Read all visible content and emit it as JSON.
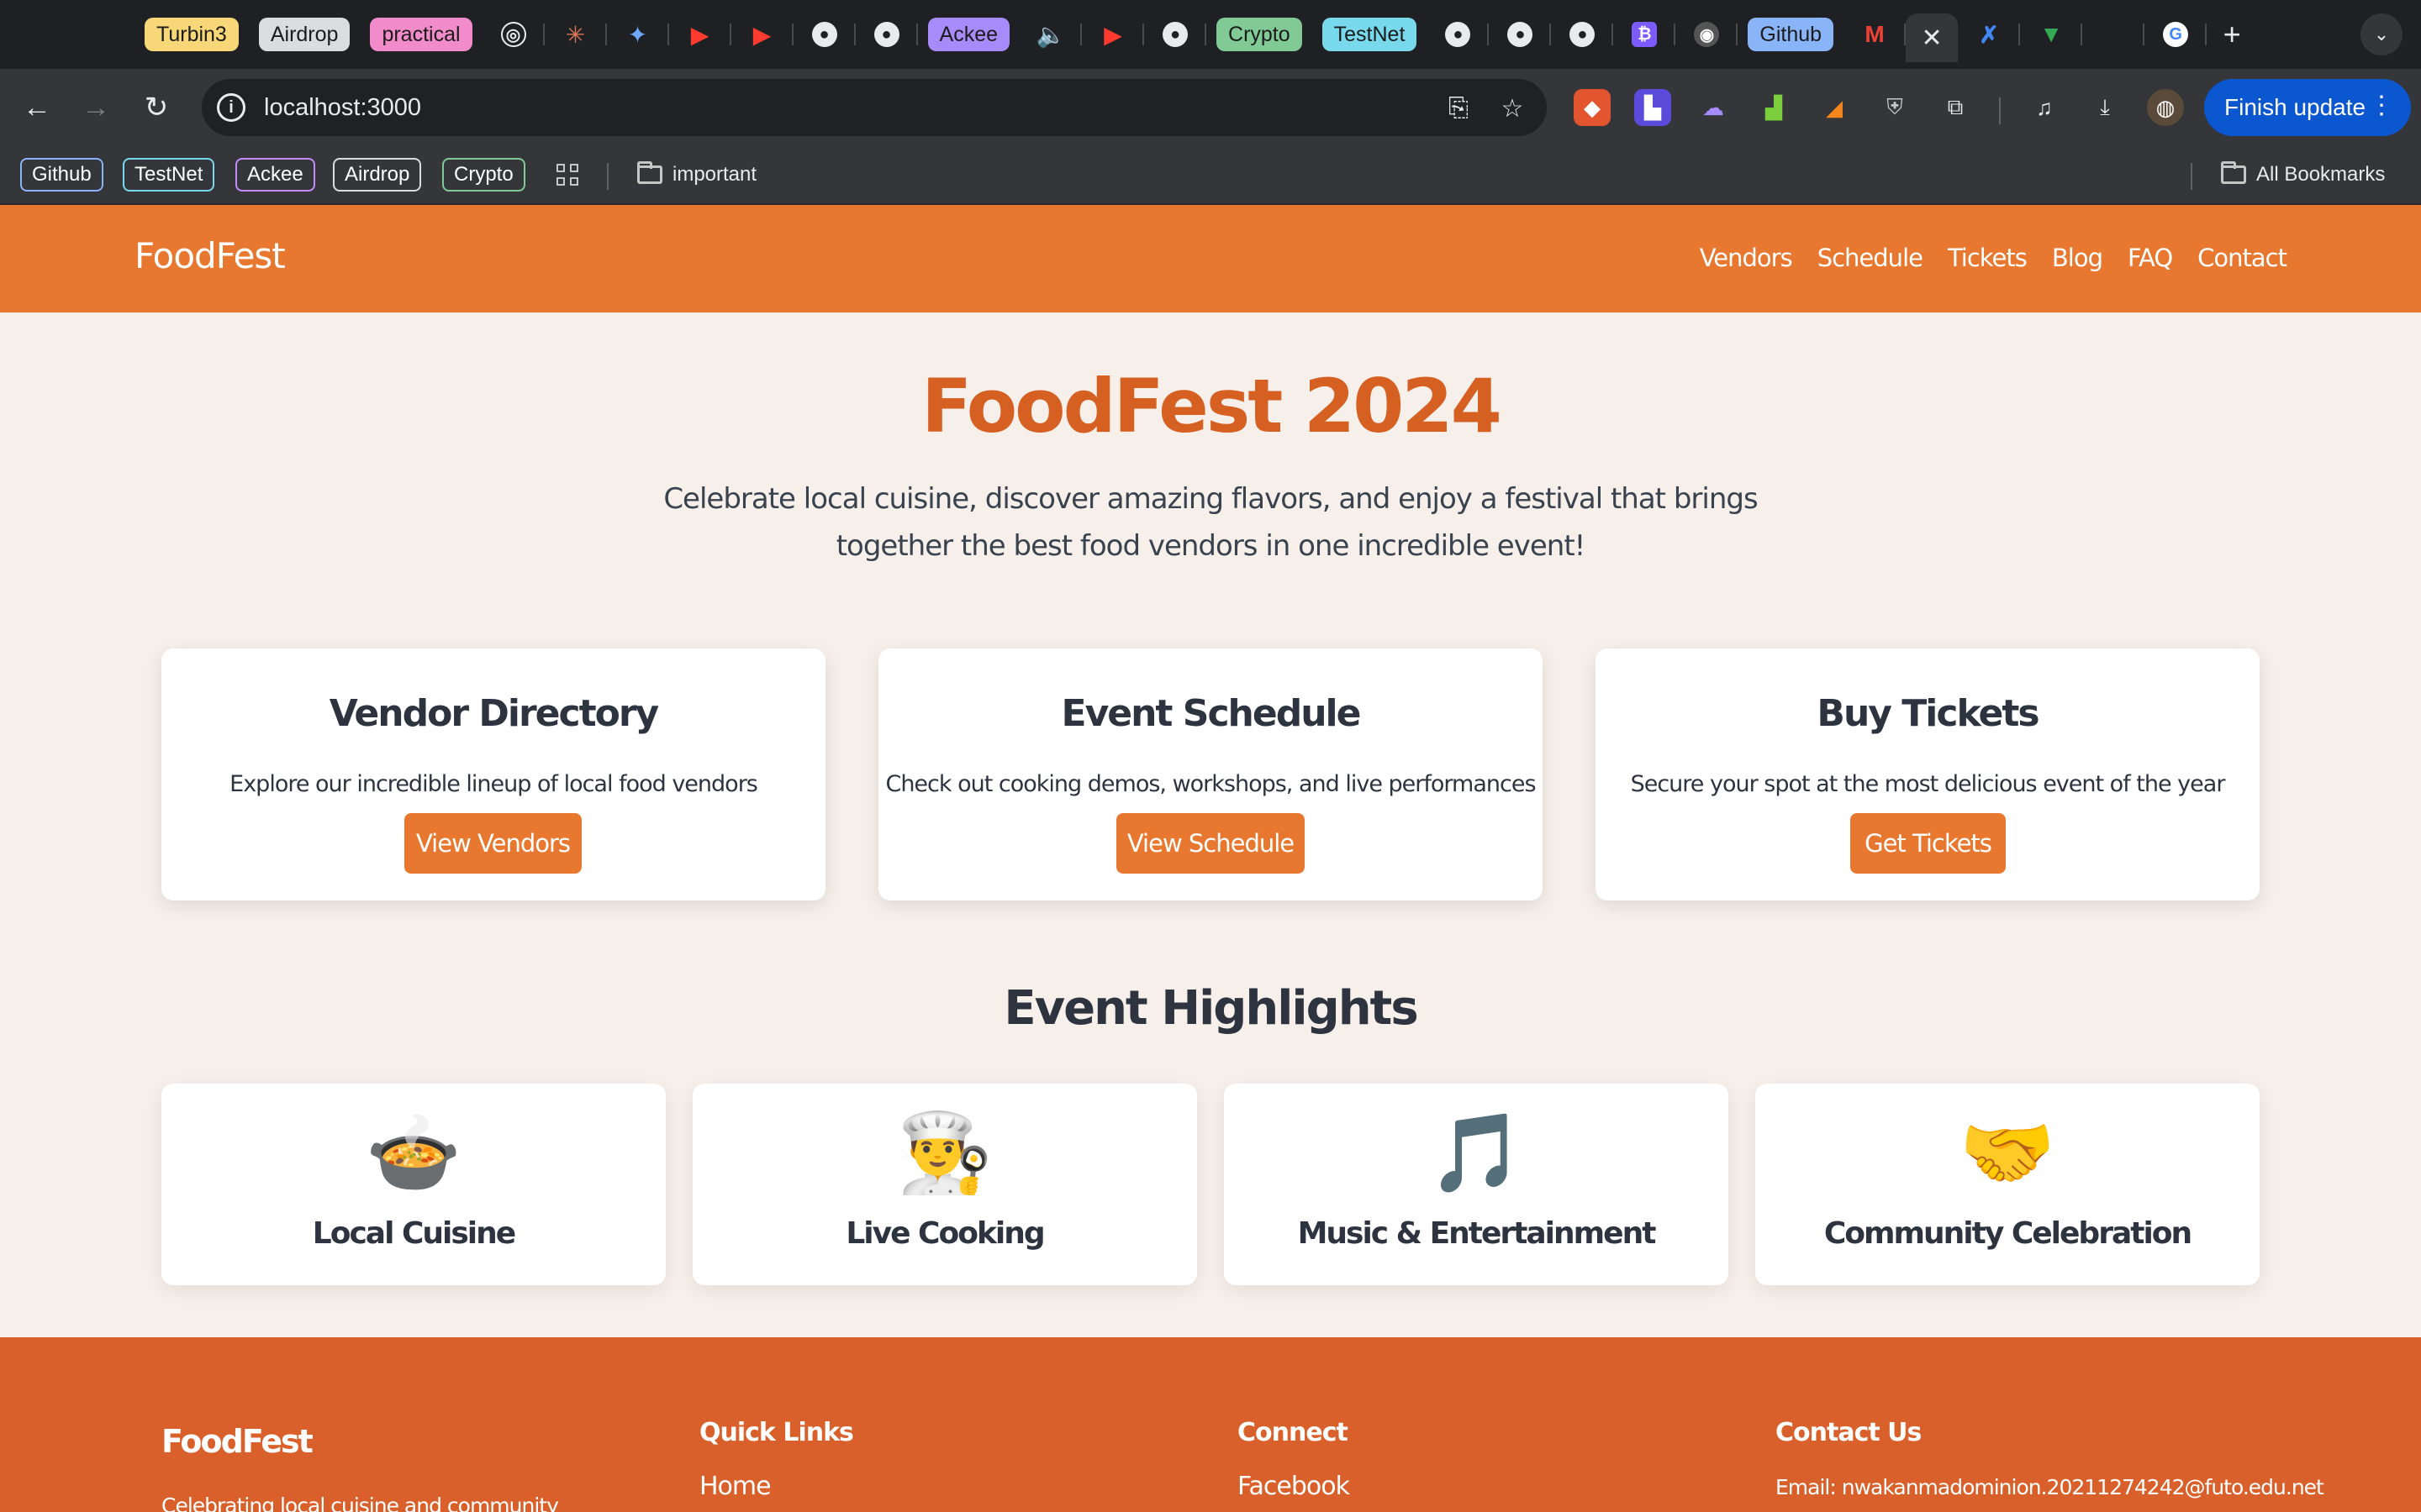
{
  "browser": {
    "tab_pills": [
      {
        "label": "Turbin3",
        "bg": "#f7d777"
      },
      {
        "label": "Airdrop",
        "bg": "#dadce0"
      },
      {
        "label": "practical",
        "bg": "#f28bc9"
      }
    ],
    "tab_pills_2": [
      {
        "label": "Ackee",
        "bg": "#a78bfa"
      },
      {
        "label": "Crypto",
        "bg": "#81c995"
      },
      {
        "label": "TestNet",
        "bg": "#78d9ec"
      },
      {
        "label": "Github",
        "bg": "#8ab4f8"
      }
    ],
    "address": "localhost:3000",
    "finish_update": "Finish update",
    "bookmarks": [
      {
        "label": "Github",
        "color": "#8ab4f8"
      },
      {
        "label": "TestNet",
        "color": "#78d9ec"
      },
      {
        "label": "Ackee",
        "color": "#c58af9"
      },
      {
        "label": "Airdrop",
        "color": "#dadce0"
      },
      {
        "label": "Crypto",
        "color": "#81c995"
      }
    ],
    "folder_important": "important",
    "all_bookmarks": "All Bookmarks"
  },
  "header": {
    "brand": "FoodFest",
    "nav": [
      "Vendors",
      "Schedule",
      "Tickets",
      "Blog",
      "FAQ",
      "Contact"
    ]
  },
  "hero": {
    "title": "FoodFest 2024",
    "subtitle": "Celebrate local cuisine, discover amazing flavors, and enjoy a festival that brings together the best food vendors in one incredible event!"
  },
  "cards": [
    {
      "title": "Vendor Directory",
      "text": "Explore our incredible lineup of local food vendors",
      "button": "View Vendors"
    },
    {
      "title": "Event Schedule",
      "text": "Check out cooking demos, workshops, and live performances",
      "button": "View Schedule"
    },
    {
      "title": "Buy Tickets",
      "text": "Secure your spot at the most delicious event of the year",
      "button": "Get Tickets"
    }
  ],
  "highlights": {
    "title": "Event Highlights",
    "items": [
      {
        "emoji": "🍲",
        "icon": "soup-bowl-icon",
        "label": "Local Cuisine"
      },
      {
        "emoji": "👨‍🍳",
        "icon": "chef-icon",
        "label": "Live Cooking"
      },
      {
        "emoji": "🎵",
        "icon": "music-note-icon",
        "label": "Music & Entertainment"
      },
      {
        "emoji": "🤝",
        "icon": "handshake-icon",
        "label": "Community Celebration"
      }
    ]
  },
  "footer": {
    "brand": "FoodFest",
    "tagline": "Celebrating local cuisine and community",
    "quick_links_title": "Quick Links",
    "quick_link_1": "Home",
    "connect_title": "Connect",
    "connect_1": "Facebook",
    "contact_title": "Contact Us",
    "contact_email": "Email: nwakanmadominion.20211274242@futo.edu.net"
  },
  "colors": {
    "header_orange": "#e8782f",
    "footer_orange": "#d9602a",
    "title_orange": "#d65f22",
    "page_bg": "#f7efe9",
    "text_dark": "#2d3440"
  }
}
